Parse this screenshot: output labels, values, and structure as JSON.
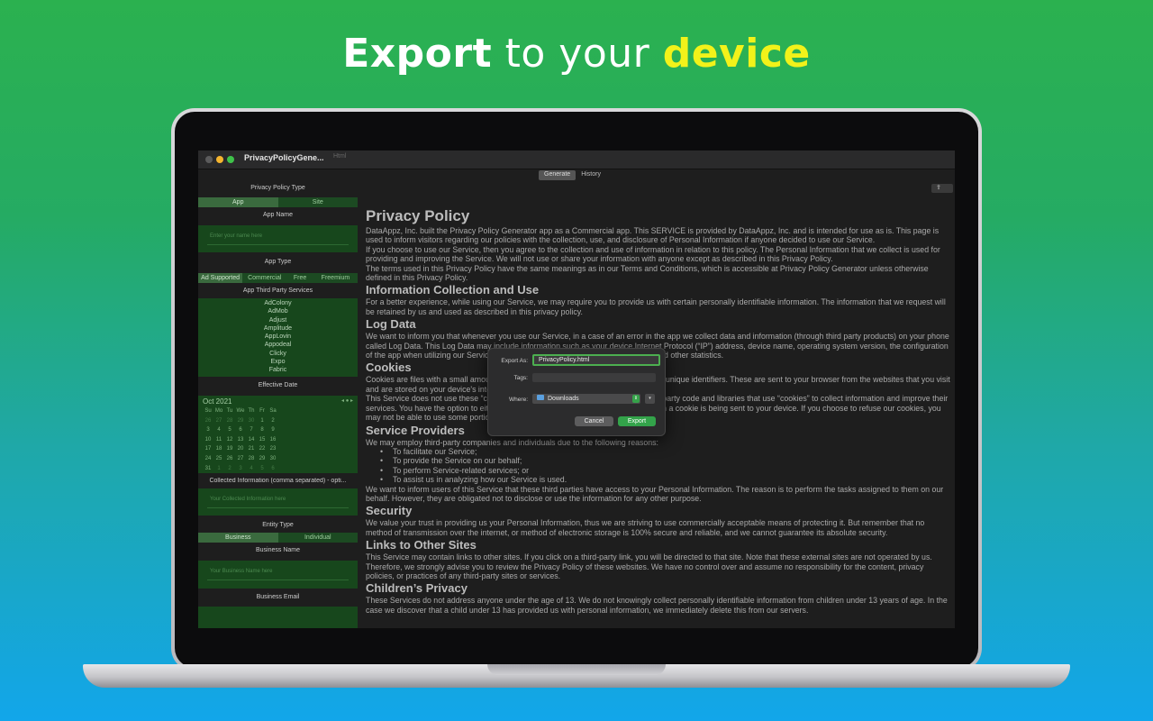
{
  "headline": {
    "part1": "Export",
    "part2": " to your ",
    "part3": "device"
  },
  "window": {
    "title": "PrivacyPolicyGene...",
    "subtitle": "Html",
    "tabs": [
      "Generate",
      "History"
    ],
    "share_icon": "share-icon"
  },
  "sidebar": {
    "policy_type_label": "Privacy Policy Type",
    "policy_type_options": [
      "App",
      "Site"
    ],
    "app_name_label": "App Name",
    "app_name_placeholder": "Enter your name here",
    "app_type_label": "App Type",
    "app_type_options": [
      "Ad Supported",
      "Commercial",
      "Free",
      "Freemium"
    ],
    "services_label": "App Third Party Services",
    "services": [
      "AdColony",
      "AdMob",
      "Adjust",
      "Amplitude",
      "AppLovin",
      "Appodeal",
      "Clicky",
      "Expo",
      "Fabric"
    ],
    "effective_date_label": "Effective Date",
    "calendar": {
      "month": "Oct 2021",
      "nav": "◂ ● ▸",
      "weekdays": [
        "Su",
        "Mo",
        "Tu",
        "We",
        "Th",
        "Fr",
        "Sa"
      ],
      "days": [
        "26",
        "27",
        "28",
        "29",
        "30",
        "1",
        "2",
        "3",
        "4",
        "5",
        "6",
        "7",
        "8",
        "9",
        "10",
        "11",
        "12",
        "13",
        "14",
        "15",
        "16",
        "17",
        "18",
        "19",
        "20",
        "21",
        "22",
        "23",
        "24",
        "25",
        "26",
        "27",
        "28",
        "29",
        "30",
        "31",
        "1",
        "2",
        "3",
        "4",
        "5",
        "6"
      ]
    },
    "collected_label": "Collected Information (comma separated) - opti...",
    "collected_placeholder": "Your Collected Information here",
    "entity_label": "Entity Type",
    "entity_options": [
      "Business",
      "Individual"
    ],
    "business_name_label": "Business Name",
    "business_name_placeholder": "Your Business Name here",
    "business_email_label": "Business Email"
  },
  "doc": {
    "title": "Privacy Policy",
    "intro1": "DataAppz, Inc. built the Privacy Policy Generator app as a Commercial app. This SERVICE is provided by DataAppz, Inc. and is intended for use as is. This page is used to inform visitors regarding our policies with the collection, use, and disclosure of Personal Information if anyone decided to use our Service.",
    "intro2": "If you choose to use our Service, then you agree to the collection and use of information in relation to this policy. The Personal Information that we collect is used for providing and improving the Service. We will not use or share your information with anyone except as described in this Privacy Policy.",
    "intro3": "The terms used in this Privacy Policy have the same meanings as in our Terms and Conditions, which is accessible at Privacy Policy Generator unless otherwise defined in this Privacy Policy.",
    "h_info": "Information Collection and Use",
    "p_info": "For a better experience, while using our Service, we may require you to provide us with certain personally identifiable information. The information that we request will be retained by us and used as described in this privacy policy.",
    "h_log": "Log Data",
    "p_log": "We want to inform you that whenever you use our Service, in a case of an error in the app we collect data and information (through third party products) on your phone called Log Data. This Log Data may include information such as your device Internet Protocol (“IP”) address, device name, operating system version, the configuration of the app when utilizing our Service, the time and date of your use of the Service, and other statistics.",
    "h_cookies": "Cookies",
    "p_cookies1": "Cookies are files with a small amount of data that are commonly used as anonymous unique identifiers. These are sent to your browser from the websites that you visit and are stored on your device's internal memory.",
    "p_cookies2": "This Service does not use these “cookies” explicitly. However, the app may use third party code and libraries that use “cookies” to collect information and improve their services. You have the option to either accept or refuse these cookies and know when a cookie is being sent to your device. If you choose to refuse our cookies, you may not be able to use some portions of this Service.",
    "h_providers": "Service Providers",
    "p_providers": "We may employ third-party companies and individuals due to the following reasons:",
    "providers_list": [
      "To facilitate our Service;",
      "To provide the Service on our behalf;",
      "To perform Service-related services; or",
      "To assist us in analyzing how our Service is used."
    ],
    "p_providers2": "We want to inform users of this Service that these third parties have access to your Personal Information. The reason is to perform the tasks assigned to them on our behalf. However, they are obligated not to disclose or use the information for any other purpose.",
    "h_security": "Security",
    "p_security": "We value your trust in providing us your Personal Information, thus we are striving to use commercially acceptable means of protecting it. But remember that no method of transmission over the internet, or method of electronic storage is 100% secure and reliable, and we cannot guarantee its absolute security.",
    "h_links": "Links to Other Sites",
    "p_links": "This Service may contain links to other sites. If you click on a third-party link, you will be directed to that site. Note that these external sites are not operated by us. Therefore, we strongly advise you to review the Privacy Policy of these websites. We have no control over and assume no responsibility for the content, privacy policies, or practices of any third-party sites or services.",
    "h_children": "Children’s Privacy",
    "p_children": "These Services do not address anyone under the age of 13. We do not knowingly collect personally identifiable information from children under 13 years of age. In the case we discover that a child under 13 has provided us with personal information, we immediately delete this from our servers."
  },
  "dialog": {
    "export_as_label": "Export As:",
    "export_as_value": "PrivacyPolicy.html",
    "tags_label": "Tags:",
    "where_label": "Where:",
    "where_value": "Downloads",
    "cancel": "Cancel",
    "export": "Export"
  },
  "colors": {
    "accent_green": "#33a34a",
    "panel_green": "#17471c",
    "headline_yellow": "#f2f21a"
  }
}
